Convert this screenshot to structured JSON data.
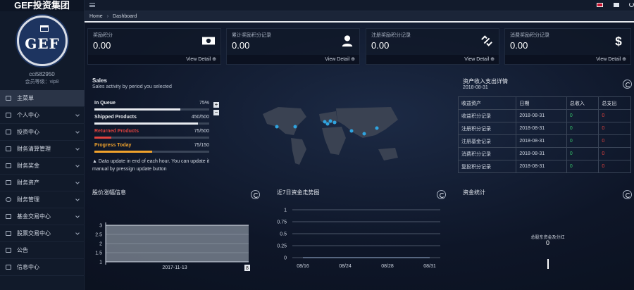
{
  "brand": {
    "title": "GEF投资集团"
  },
  "logo": {
    "monogram": "GEF"
  },
  "user": {
    "id": "cci582950",
    "level": "会员等级：vip8"
  },
  "sidebar": {
    "items": [
      {
        "label": "主菜单",
        "active": true,
        "chevron": false
      },
      {
        "label": "个人中心",
        "active": false,
        "chevron": true
      },
      {
        "label": "投资中心",
        "active": false,
        "chevron": true
      },
      {
        "label": "财务清算管理",
        "active": false,
        "chevron": true
      },
      {
        "label": "财务奖金",
        "active": false,
        "chevron": true
      },
      {
        "label": "财务资产",
        "active": false,
        "chevron": true
      },
      {
        "label": "财务管理",
        "active": false,
        "chevron": true
      },
      {
        "label": "基金交易中心",
        "active": false,
        "chevron": true
      },
      {
        "label": "股票交易中心",
        "active": false,
        "chevron": true
      },
      {
        "label": "公告",
        "active": false,
        "chevron": false
      },
      {
        "label": "信息中心",
        "active": false,
        "chevron": false
      }
    ]
  },
  "breadcrumb": {
    "home": "Home",
    "current": "Dashboard"
  },
  "cards": [
    {
      "label": "奖励积分",
      "value": "0.00",
      "footer": "View Detail ⊕",
      "icon": "money-icon"
    },
    {
      "label": "累计奖励积分记录",
      "value": "0.00",
      "footer": "View Detail ⊕",
      "icon": "user-icon"
    },
    {
      "label": "注册奖励积分记录",
      "value": "0.00",
      "footer": "View Detail ⊕",
      "icon": "unlink-icon"
    },
    {
      "label": "消费奖励积分记录",
      "value": "0.00",
      "footer": "View Detail ⊕",
      "icon": "dollar-icon"
    }
  ],
  "sales": {
    "title": "Sales",
    "subtitle": "Sales activity by period you selected",
    "rows": [
      {
        "name": "In Queue",
        "value": "75%",
        "fraction": 0.75,
        "color": "#e8ebf0",
        "name_color": "#e8ebf0"
      },
      {
        "name": "Shipped Products",
        "value": "450/500",
        "fraction": 0.9,
        "color": "#e8ebf0",
        "name_color": "#e8ebf0"
      },
      {
        "name": "Returned Products",
        "value": "75/500",
        "fraction": 0.15,
        "color": "#e0423e",
        "name_color": "#e0423e"
      },
      {
        "name": "Progress Today",
        "value": "75/150",
        "fraction": 0.5,
        "color": "#f0a22c",
        "name_color": "#f0a22c"
      }
    ],
    "note": "Data update in end of each hour. You can update it manual by pressign update button"
  },
  "map": {
    "zoom_in": "+",
    "zoom_out": "−"
  },
  "asset_table": {
    "title": "资产收入支出详情",
    "date": "2018-08-31",
    "headers": [
      "收益资产",
      "日期",
      "总收入",
      "总支出"
    ],
    "rows": [
      {
        "name": "收益积分记录",
        "date": "2018-08-31",
        "income": "0",
        "expense": "0"
      },
      {
        "name": "注册积分记录",
        "date": "2018-08-31",
        "income": "0",
        "expense": "0"
      },
      {
        "name": "注册基金记录",
        "date": "2018-08-31",
        "income": "0",
        "expense": "0"
      },
      {
        "name": "消费积分记录",
        "date": "2018-08-31",
        "income": "0",
        "expense": "0"
      },
      {
        "name": "复投积分记录",
        "date": "2018-08-31",
        "income": "0",
        "expense": "0"
      }
    ]
  },
  "panels": {
    "stock": "股价涨幅信息",
    "trend": "近7日资金走势图",
    "funds": "资金统计"
  },
  "stock_chart": {
    "y_ticks": [
      "1",
      "1.5",
      "2",
      "2.5",
      "3"
    ],
    "x_label": "2017-11-13",
    "end_label": "8"
  },
  "trend_chart": {
    "y_ticks": [
      "0",
      "0.25",
      "0.5",
      "0.75",
      "1"
    ],
    "x_ticks": [
      "08/16",
      "08/24",
      "08/28",
      "08/31"
    ]
  },
  "funds_panel": {
    "label": "总股东资金及分红",
    "value": "0"
  },
  "chart_data": [
    {
      "type": "area",
      "title": "股价涨幅信息",
      "x": [
        "2017-11-13"
      ],
      "series": [
        {
          "values": [
            3
          ]
        }
      ],
      "ylim": [
        1,
        3
      ],
      "grid": true
    },
    {
      "type": "line",
      "title": "近7日资金走势图",
      "x": [
        "08/16",
        "08/24",
        "08/28",
        "08/31"
      ],
      "series": [
        {
          "values": [
            0,
            0,
            0,
            0
          ]
        }
      ],
      "ylim": [
        0,
        1
      ],
      "grid": true
    }
  ]
}
